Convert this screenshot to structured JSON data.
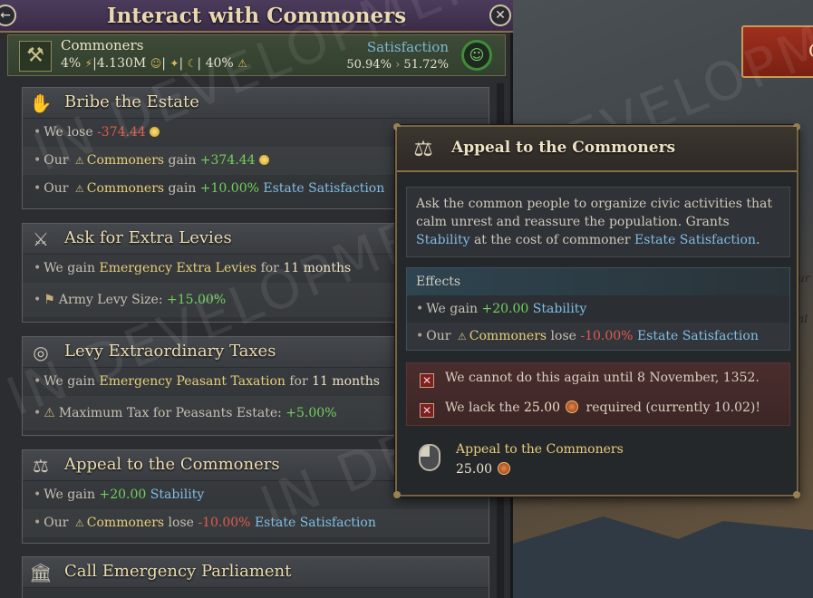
{
  "window": {
    "title": "Interact with Commoners",
    "back_icon": "arrow-left-icon",
    "close_icon": "close-icon"
  },
  "estate": {
    "name": "Commoners",
    "power_pct": "4%",
    "population": "4.130M",
    "loyalty_pct": "40%",
    "satisfaction_label": "Satisfaction",
    "satisfaction_from": "50.94%",
    "satisfaction_to": "51.72%"
  },
  "actions": [
    {
      "title": "Bribe the Estate",
      "icon": "hand-coin-icon",
      "lines": [
        {
          "prefix": "We lose ",
          "value": "-374.44"
        },
        {
          "prefix": "Our ",
          "subject": "Commoners",
          "mid": " gain ",
          "value": "+374.44"
        },
        {
          "prefix": "Our ",
          "subject": "Commoners",
          "mid": " gain ",
          "value": "+10.00%",
          "suffix": "Estate Satisfaction"
        }
      ]
    },
    {
      "title": "Ask for Extra Levies",
      "icon": "crossed-spears-icon",
      "lines": [
        {
          "prefix": "We gain ",
          "subject": "Emergency Extra Levies",
          "mid": " for ",
          "value": "11 months"
        },
        {
          "prefix": "Army Levy Size: ",
          "value": "+15.00%"
        }
      ]
    },
    {
      "title": "Levy Extraordinary Taxes",
      "icon": "coin-stack-icon",
      "lines": [
        {
          "prefix": "We gain ",
          "subject": "Emergency Peasant Taxation",
          "mid": " for ",
          "value": "11 months"
        },
        {
          "prefix": "Maximum Tax for Peasants Estate: ",
          "value": "+5.00%"
        }
      ]
    },
    {
      "title": "Appeal to the Commoners",
      "icon": "scales-icon",
      "lines": [
        {
          "prefix": "We gain ",
          "value": "+20.00",
          "suffix": "Stability"
        },
        {
          "prefix": "Our ",
          "subject": "Commoners",
          "mid": " lose ",
          "value": "-10.00%",
          "suffix": "Estate Satisfaction"
        }
      ]
    },
    {
      "title": "Call Emergency Parliament",
      "icon": "parliament-icon",
      "lines": []
    }
  ],
  "tooltip": {
    "title": "Appeal to the Commoners",
    "desc_1": "Ask the common people to organize civic activities that calm unrest and reassure the population. Grants ",
    "desc_stability": "Stability",
    "desc_2": " at the cost of commoner ",
    "desc_estate_sat": "Estate Satisfaction",
    "desc_3": ".",
    "effects_header": "Effects",
    "effect_1_prefix": "We gain ",
    "effect_1_value": "+20.00",
    "effect_1_suffix": "Stability",
    "effect_2_prefix": "Our ",
    "effect_2_subject": "Commoners",
    "effect_2_mid": " lose ",
    "effect_2_value": "-10.00%",
    "effect_2_suffix": "Estate Satisfaction",
    "req_1": "We cannot do this again until 8 November, 1352.",
    "req_2_prefix": "We lack the ",
    "req_2_value": "25.00",
    "req_2_suffix": " required (currently 10.02)!",
    "cost_name": "Appeal to the Commoners",
    "cost_value": "25.00"
  },
  "watermark": "IN DEVELOPMENT",
  "map": {
    "banner_text": "C",
    "label_1": "ur",
    "label_2": "al"
  },
  "colors": {
    "positive": "#72d05c",
    "negative": "#e05a4c",
    "link_blue": "#80bde4",
    "highlight_yellow": "#e8cf7a"
  }
}
